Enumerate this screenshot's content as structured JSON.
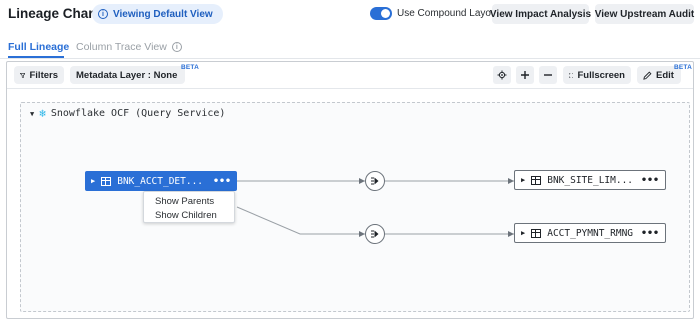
{
  "header": {
    "title": "Lineage Chart",
    "view_pill": "Viewing Default View",
    "compound_layout_label": "Use Compound Layout",
    "compound_layout_on": true,
    "impact_button": "View Impact Analysis",
    "upstream_button": "View Upstream Audit"
  },
  "tabs": [
    {
      "label": "Full Lineage",
      "active": true
    },
    {
      "label": "Column Trace View",
      "active": false
    }
  ],
  "toolbar": {
    "filters_label": "Filters",
    "metadata_label": "Metadata Layer : None",
    "metadata_badge": "BETA",
    "fullscreen_label": "Fullscreen",
    "edit_label": "Edit",
    "edit_badge": "BETA"
  },
  "group": {
    "title": "Snowflake OCF (Query Service)"
  },
  "nodes": {
    "source": {
      "name": "BNK_ACCT_DET...",
      "selected": true
    },
    "target_1": {
      "name": "BNK_SITE_LIM..."
    },
    "target_2": {
      "name": "ACCT_PYMNT_RMNG"
    }
  },
  "context_menu": {
    "items": [
      "Show Parents",
      "Show Children"
    ]
  },
  "icons": {
    "info": "info-icon",
    "filter": "funnel-icon",
    "chevron": "chevron-down-icon",
    "fit": "fit-view-icon",
    "zoom_in": "plus-icon",
    "zoom_out": "minus-icon",
    "fullscreen": "expand-icon",
    "edit": "pencil-icon",
    "table": "table-icon",
    "process": "process-icon",
    "snowflake": "snowflake-icon"
  },
  "colors": {
    "accent": "#2a6fd6",
    "snowflake": "#29b5e8"
  }
}
